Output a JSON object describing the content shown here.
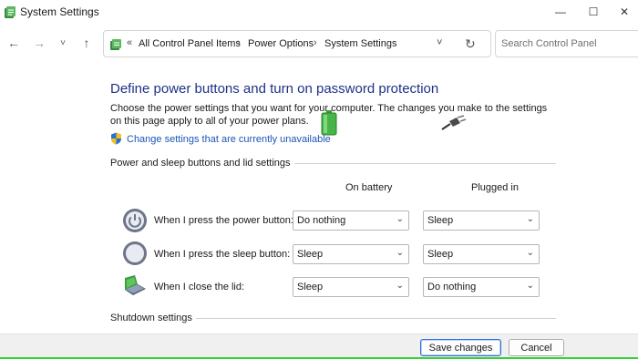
{
  "window": {
    "title": "System Settings",
    "min_glyph": "—",
    "max_glyph": "☐",
    "close_glyph": "✕"
  },
  "nav": {
    "back_glyph": "←",
    "forward_glyph": "→",
    "recent_glyph": "˅",
    "up_glyph": "↑",
    "breadcrumb_overflow": "«",
    "breadcrumbs": [
      "All Control Panel Items",
      "Power Options",
      "System Settings"
    ],
    "separator": "›",
    "dropdown_glyph": "˅",
    "refresh_glyph": "↻",
    "search_placeholder": "Search Control Panel"
  },
  "page": {
    "heading": "Define power buttons and turn on password protection",
    "description": "Choose the power settings that you want for your computer. The changes you make to the settings on this page apply to all of your power plans.",
    "change_link": "Change settings that are currently unavailable"
  },
  "power_section": {
    "title": "Power and sleep buttons and lid settings",
    "col_battery": "On battery",
    "col_plugged": "Plugged in",
    "rows": [
      {
        "label": "When I press the power button:",
        "on_battery": "Do nothing",
        "plugged_in": "Sleep",
        "icon": "power-button-icon"
      },
      {
        "label": "When I press the sleep button:",
        "on_battery": "Sleep",
        "plugged_in": "Sleep",
        "icon": "sleep-button-icon"
      },
      {
        "label": "When I close the lid:",
        "on_battery": "Sleep",
        "plugged_in": "Do nothing",
        "icon": "laptop-lid-icon"
      }
    ]
  },
  "shutdown_section": {
    "title": "Shutdown settings"
  },
  "footer": {
    "save_label": "Save changes",
    "cancel_label": "Cancel"
  },
  "caret_glyph": "⌄",
  "colors": {
    "heading": "#1e3287",
    "link": "#1a56b8",
    "primary_border": "#2f6ed8",
    "accent_bar": "#36d13b"
  }
}
